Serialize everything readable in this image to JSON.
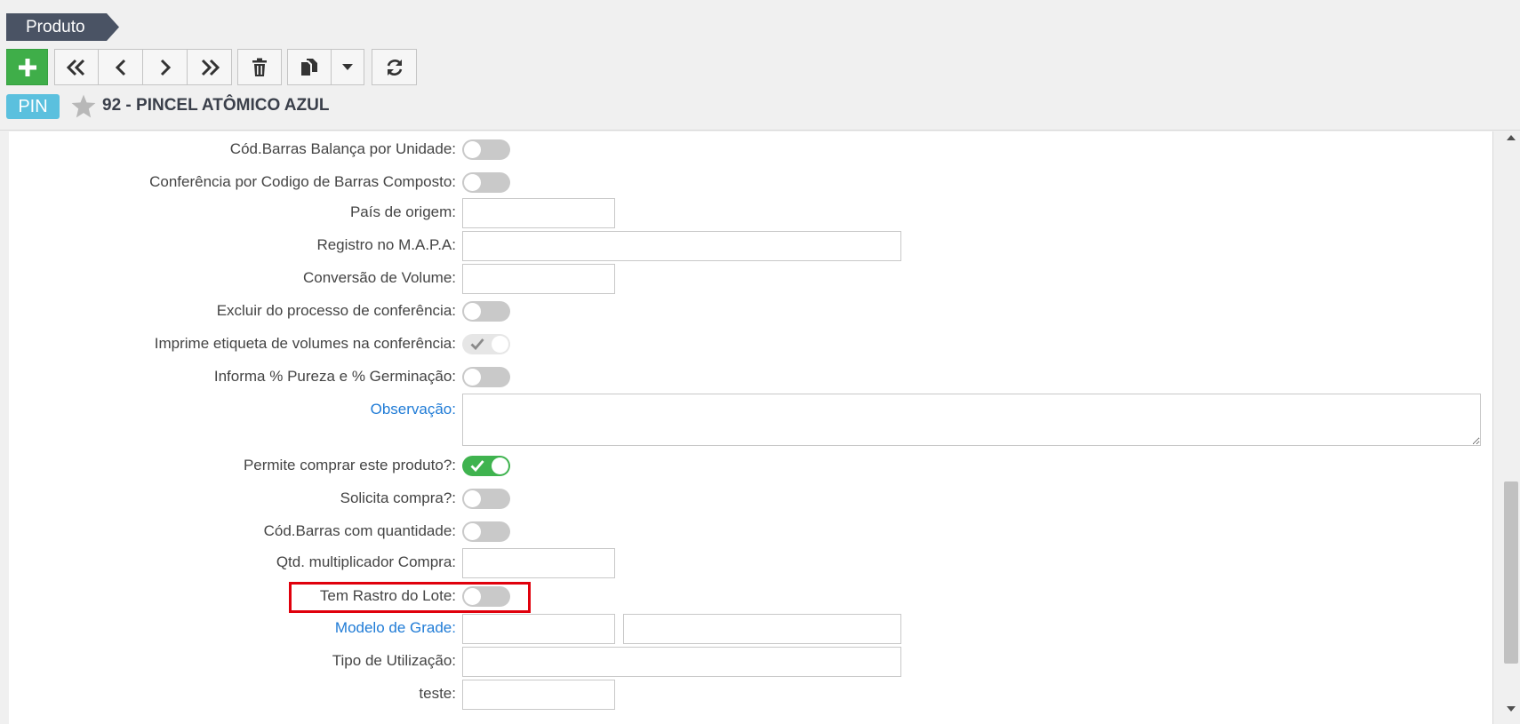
{
  "breadcrumb": {
    "label": "Produto"
  },
  "toolbar": {
    "new_icon": "plus-icon",
    "nav_icons": [
      "double-chevron-left-icon",
      "chevron-left-icon",
      "chevron-right-icon",
      "double-chevron-right-icon"
    ],
    "delete_icon": "trash-icon",
    "copy_icon": "copy-icon",
    "dropdown_icon": "caret-down-icon",
    "refresh_icon": "refresh-icon"
  },
  "record": {
    "badge": "PIN",
    "favorite_icon": "star-icon",
    "title": "92 - PINCEL ATÔMICO AZUL"
  },
  "form": {
    "fields": [
      {
        "label": "Cód.Barras Balança por Unidade:",
        "type": "toggle",
        "checked": false
      },
      {
        "label": "Conferência por Codigo de Barras Composto:",
        "type": "toggle",
        "checked": false
      },
      {
        "label": "País de origem:",
        "type": "text",
        "value": ""
      },
      {
        "label": "Registro no M.A.P.A:",
        "type": "text",
        "value": ""
      },
      {
        "label": "Conversão de Volume:",
        "type": "text",
        "value": ""
      },
      {
        "label": "Excluir do processo de conferência:",
        "type": "toggle",
        "checked": false
      },
      {
        "label": "Imprime etiqueta de volumes na conferência:",
        "type": "toggle",
        "checked": true,
        "readonly": true
      },
      {
        "label": "Informa % Pureza e % Germinação:",
        "type": "toggle",
        "checked": false
      },
      {
        "label": "Observação:",
        "type": "textarea",
        "value": ""
      },
      {
        "label": "Permite comprar este produto?:",
        "type": "toggle",
        "checked": true
      },
      {
        "label": "Solicita compra?:",
        "type": "toggle",
        "checked": false
      },
      {
        "label": "Cód.Barras com quantidade:",
        "type": "toggle",
        "checked": false
      },
      {
        "label": "Qtd. multiplicador Compra:",
        "type": "text",
        "value": ""
      },
      {
        "label": "Tem Rastro do Lote:",
        "type": "toggle",
        "checked": false
      },
      {
        "label": "Modelo de Grade:",
        "type": "lookup",
        "value": "",
        "description": ""
      },
      {
        "label": "Tipo de Utilização:",
        "type": "select",
        "value": ""
      },
      {
        "label": "teste:",
        "type": "text",
        "value": ""
      }
    ]
  },
  "colors": {
    "accent_green": "#3fae49",
    "link_blue": "#1f7bd6",
    "badge_blue": "#5bc0de",
    "highlight_red": "#e0000c"
  }
}
